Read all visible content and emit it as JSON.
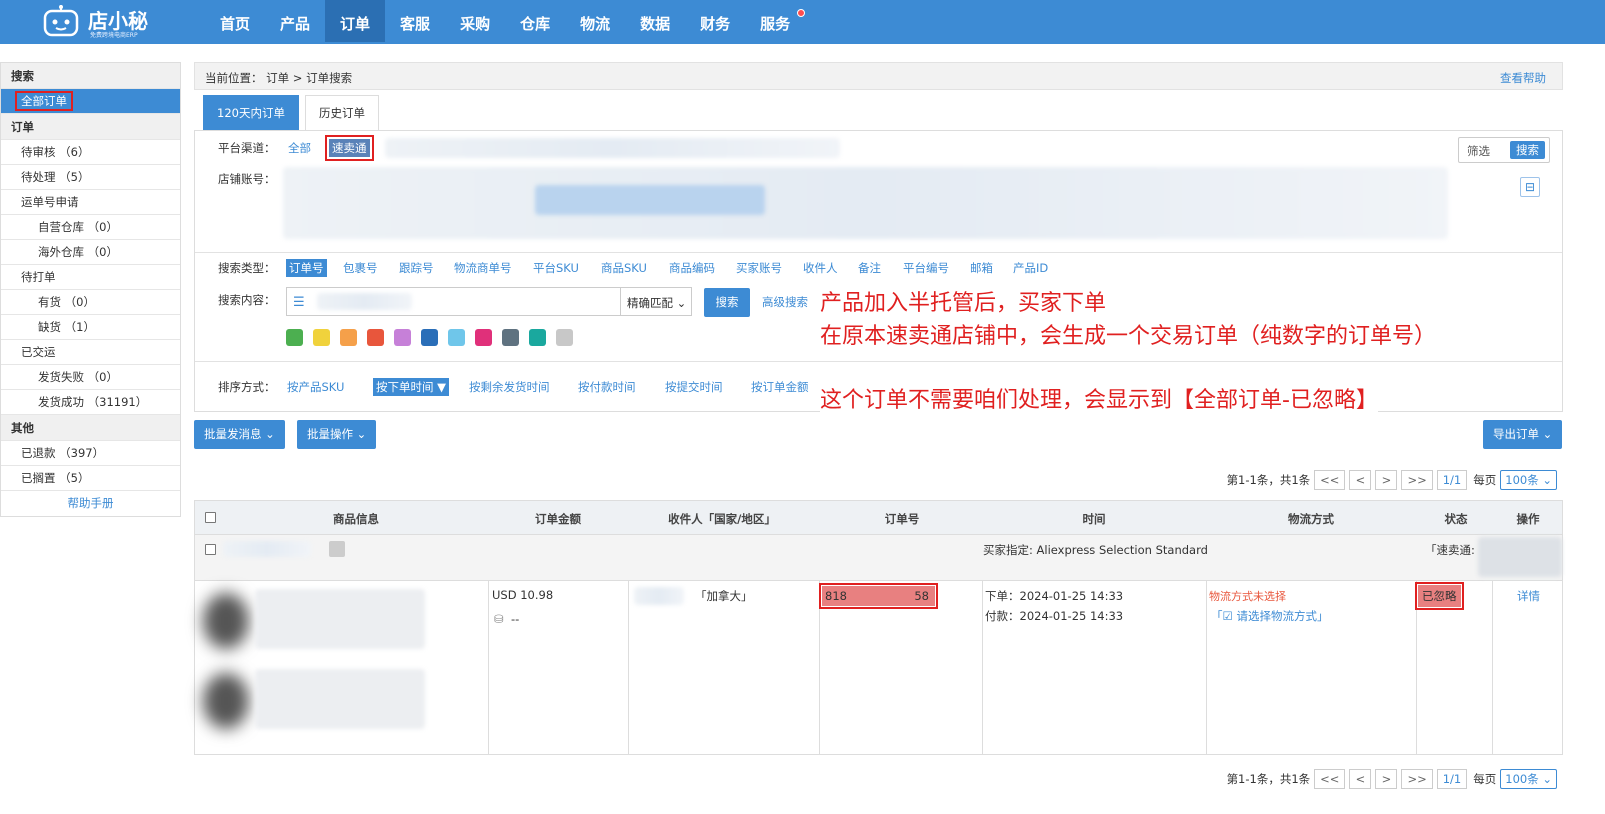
{
  "app": {
    "brand": "店小秘",
    "slogan": "免费跨境电商ERP"
  },
  "nav": {
    "items": [
      "首页",
      "产品",
      "订单",
      "客服",
      "采购",
      "仓库",
      "物流",
      "数据",
      "财务",
      "服务"
    ],
    "active_index": 2,
    "dot_color": "#ff4d4f"
  },
  "sidebar": {
    "search_head": "搜索",
    "all_orders": "全部订单",
    "order_head": "订单",
    "pending_review": "待审核 （6）",
    "pending_process": "待处理 （5）",
    "tracking_apply": "运单号申请",
    "self_warehouse": "自营仓库 （0）",
    "overseas_warehouse": "海外仓库 （0）",
    "to_print": "待打单",
    "in_stock": "有货 （0）",
    "out_of_stock": "缺货 （1）",
    "shipped": "已交运",
    "ship_failed": "发货失败 （0）",
    "ship_success": "发货成功 （31191）",
    "other_head": "其他",
    "refunded": "已退款 （397）",
    "on_hold": "已搁置 （5）",
    "help": "帮助手册"
  },
  "breadcrumb": {
    "text": "当前位置： 订单 > 订单搜索",
    "help": "查看帮助"
  },
  "tabs": [
    "120天内订单",
    "历史订单"
  ],
  "filter": {
    "platform_label": "平台渠道：",
    "platform_all": "全部",
    "platform_selected": "速卖通",
    "store_label": "店铺账号：",
    "screen_btn": "筛选",
    "search_btn": "搜索",
    "search_type_label": "搜索类型：",
    "search_types": [
      "订单号",
      "包裹号",
      "跟踪号",
      "物流商单号",
      "平台SKU",
      "商品SKU",
      "商品编码",
      "买家账号",
      "收件人",
      "备注",
      "平台编号",
      "邮箱",
      "产品ID"
    ],
    "search_content_label": "搜索内容：",
    "match_mode": "精确匹配 ⌄",
    "do_search": "搜索",
    "advanced": "高级搜索",
    "flag_colors": [
      "#4caf50",
      "#f0d23c",
      "#f5a04a",
      "#e8563c",
      "#c680d8",
      "#2a6eb8",
      "#6fc6ea",
      "#e0307a",
      "#5f7280",
      "#1aa89e",
      "#c8c8c8"
    ],
    "sort_label": "排序方式：",
    "sort_options": [
      "按产品SKU",
      "按下单时间 ▼",
      "按剩余发货时间",
      "按付款时间",
      "按提交时间",
      "按订单金额"
    ]
  },
  "annotations": {
    "line1": "产品加入半托管后，买家下单",
    "line2": "在原本速卖通店铺中，会生成一个交易订单（纯数字的订单号）",
    "line3": "这个订单不需要咱们处理，会显示到【全部订单-已忽略】",
    "color": "#e02020"
  },
  "actions": {
    "batch_msg": "批量发消息 ⌄",
    "batch_op": "批量操作 ⌄",
    "export": "导出订单 ⌄"
  },
  "pager": {
    "summary": "第1-1条，共1条",
    "first": "<<",
    "prev": "<",
    "next": ">",
    "last": ">>",
    "page": "1/1",
    "per_page_label": "每页",
    "per_page": "100条 ⌄"
  },
  "table": {
    "headers": [
      "商品信息",
      "订单金额",
      "收件人「国家/地区」",
      "订单号",
      "时间",
      "物流方式",
      "状态",
      "操作"
    ],
    "group": {
      "buyer_specified": "买家指定:  Aliexpress Selection Standard",
      "platform_tag": "「速卖通:"
    },
    "row": {
      "amount": "USD 10.98",
      "amount_sub": "--",
      "country": "「加拿大」",
      "order_no_left": "818",
      "order_no_right": "58",
      "order_time": "下单：2024-01-25 14:33",
      "pay_time": "付款：2024-01-25 14:33",
      "logistics_unset": "物流方式未选择",
      "logistics_choose": "「☑ 请选择物流方式」",
      "status": "已忽略",
      "detail": "详情"
    }
  }
}
